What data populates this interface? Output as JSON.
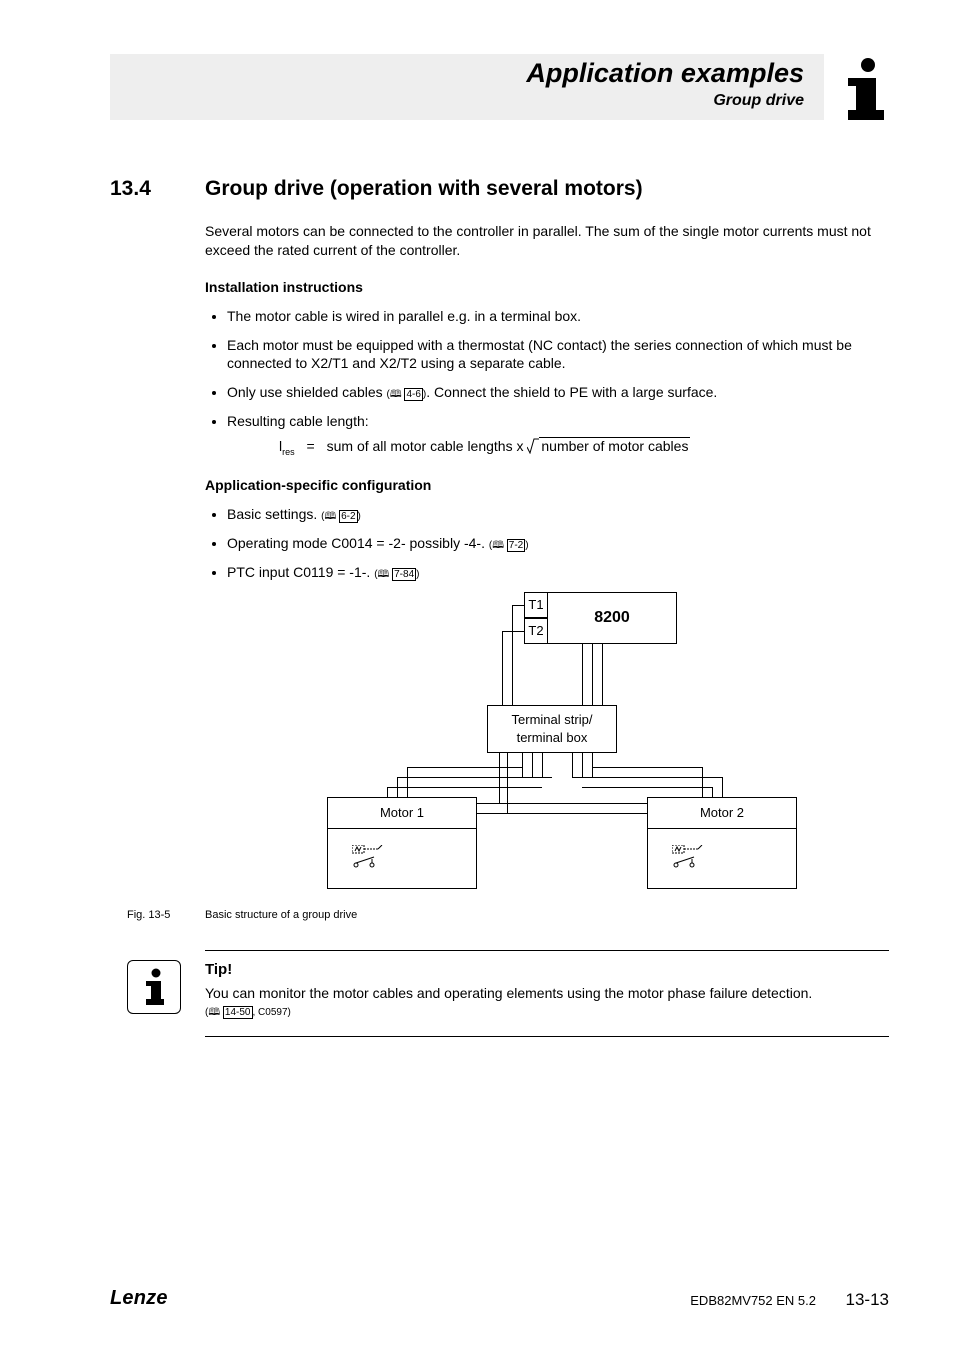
{
  "header": {
    "title": "Application examples",
    "subtitle": "Group drive"
  },
  "section": {
    "number": "13.4",
    "title": "Group drive (operation with several motors)"
  },
  "intro": "Several motors can be connected to the controller in parallel. The sum of the single motor currents must not exceed the rated current of the controller.",
  "install": {
    "heading": "Installation instructions",
    "bullet1": "The motor cable is wired in parallel e.g. in a terminal box.",
    "bullet2": "Each motor must be equipped with a thermostat (NC contact) the series connection of which must be connected to X2/T1 and X2/T2 using a separate cable.",
    "bullet3_a": "Only use shielded cables ",
    "bullet3_ref": "4-6",
    "bullet3_b": ". Connect the shield to PE with a large surface.",
    "bullet4": "Resulting cable length:",
    "formula_lhs_sym": "l",
    "formula_lhs_sub": "res",
    "formula_eq": "=",
    "formula_text": "sum of all motor cable lengths x ",
    "formula_radicand": "number of motor cables"
  },
  "appcfg": {
    "heading": "Application-specific configuration",
    "b1_text": "Basic settings. ",
    "b1_ref": "6-2",
    "b2_text": "Operating mode C0014 = -2- possibly -4-. ",
    "b2_ref": "7-2",
    "b3_text": "PTC input C0119 = -1-. ",
    "b3_ref": "7-84"
  },
  "diagram": {
    "t1": "T1",
    "t2": "T2",
    "controller": "8200",
    "terminal": "Terminal strip/\nterminal box",
    "motor1": "Motor 1",
    "motor2": "Motor 2"
  },
  "figure": {
    "number": "Fig. 13-5",
    "caption": "Basic structure of a group drive"
  },
  "tip": {
    "title": "Tip!",
    "body": "You can monitor the motor cables and operating elements using the motor phase failure detection.",
    "ref": "14-50",
    "code": ", C0597)"
  },
  "footer": {
    "logo": "Lenze",
    "doc": "EDB82MV752 EN 5.2",
    "page": "13-13"
  }
}
